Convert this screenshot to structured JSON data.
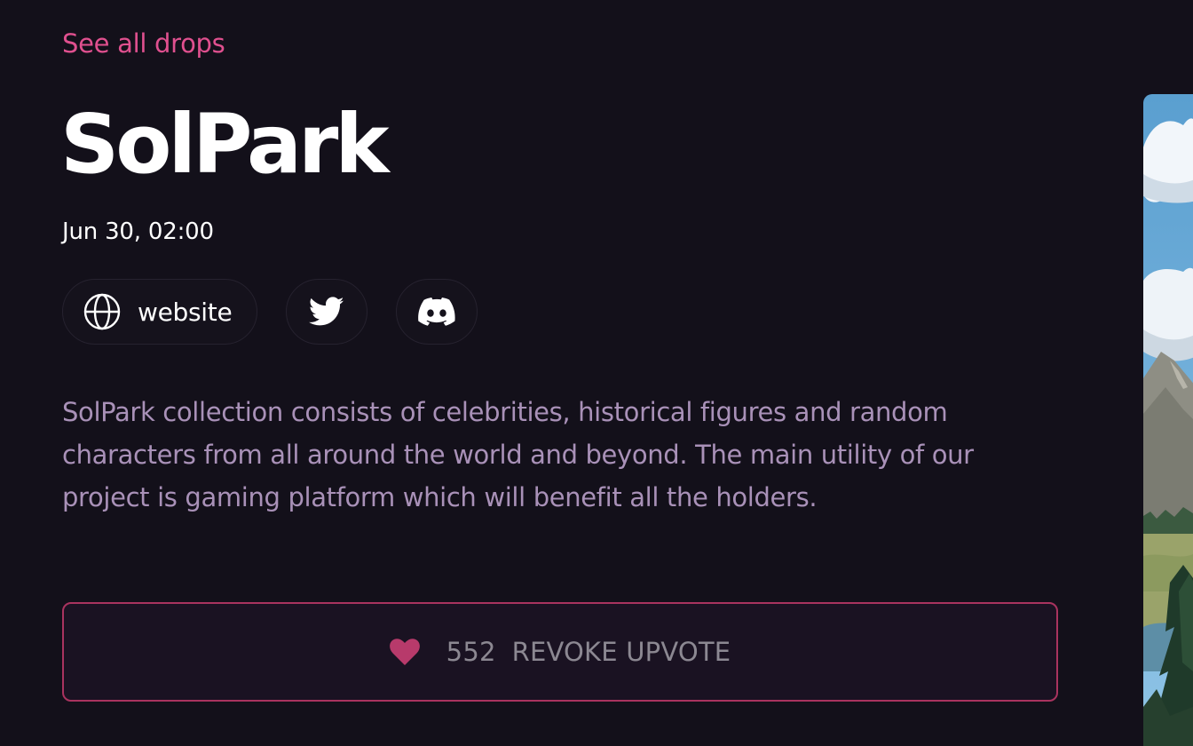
{
  "nav": {
    "back_label": "See all drops"
  },
  "drop": {
    "title": "SolPark",
    "date": "Jun 30, 02:00",
    "description": "SolPark collection consists of celebrities, historical figures and random characters from all around the world and beyond. The main utility of our project is gaming platform which will benefit all the holders."
  },
  "links": {
    "website_label": "website",
    "twitter_icon": "twitter-icon",
    "discord_icon": "discord-icon",
    "globe_icon": "globe-icon"
  },
  "upvote": {
    "count": "552",
    "label": "REVOKE UPVOTE",
    "icon": "heart-icon"
  },
  "colors": {
    "background": "#13101a",
    "accent": "#e0508f",
    "upvote_border": "#a9335f",
    "heart": "#b83a6b",
    "description_text": "#a991b8"
  }
}
